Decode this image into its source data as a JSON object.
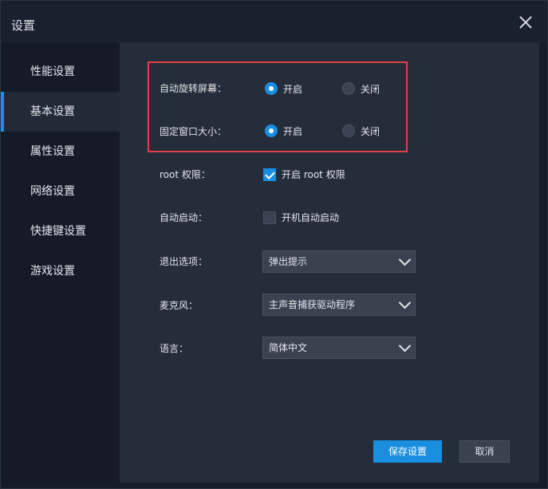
{
  "window": {
    "title": "设置"
  },
  "sidebar": {
    "items": [
      {
        "label": "性能设置",
        "active": false
      },
      {
        "label": "基本设置",
        "active": true
      },
      {
        "label": "属性设置",
        "active": false
      },
      {
        "label": "网络设置",
        "active": false
      },
      {
        "label": "快捷键设置",
        "active": false
      },
      {
        "label": "游戏设置",
        "active": false
      }
    ]
  },
  "settings": {
    "auto_rotate": {
      "label": "自动旋转屏幕：",
      "on_label": "开启",
      "off_label": "关闭",
      "value": "on"
    },
    "fixed_window": {
      "label": "固定窗口大小：",
      "on_label": "开启",
      "off_label": "关闭",
      "value": "on"
    },
    "root": {
      "label": "root 权限：",
      "checkbox_label": "开启 root 权限",
      "checked": true
    },
    "autostart": {
      "label": "自动启动：",
      "checkbox_label": "开机自动启动",
      "checked": false
    },
    "exit_option": {
      "label": "退出选项：",
      "value": "弹出提示"
    },
    "microphone": {
      "label": "麦克风：",
      "value": "主声音捕获驱动程序"
    },
    "language": {
      "label": "语言：",
      "value": "简体中文"
    }
  },
  "footer": {
    "save_label": "保存设置",
    "cancel_label": "取消"
  },
  "colors": {
    "accent": "#1a8fe0",
    "highlight_border": "#e0414a"
  }
}
